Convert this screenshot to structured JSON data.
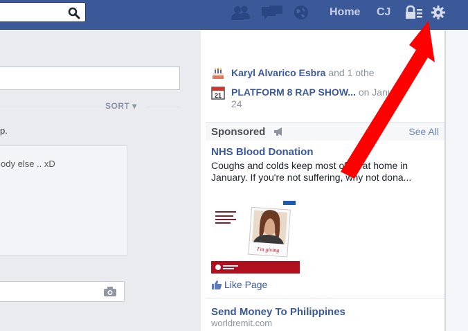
{
  "topbar": {
    "home_label": "Home",
    "user_label": "CJ",
    "icons": [
      "friend-requests-icon",
      "messages-icon",
      "notifications-globe-icon",
      "privacy-shortcuts-icon",
      "settings-gear-icon"
    ]
  },
  "feed": {
    "sort_label": "SORT ▾",
    "story_text": "p.",
    "comment_text": "ody else .. xD"
  },
  "reminders": {
    "birthday": {
      "name": "Karyl Alvarico Esbra",
      "suffix": "and 1 othe"
    },
    "event": {
      "name": "PLATFORM 8 RAP SHOW...",
      "suffix": "on January",
      "date_line": "24"
    }
  },
  "sponsored": {
    "title": "Sponsored",
    "see_all": "See All",
    "ads": [
      {
        "title": "NHS Blood Donation",
        "body": "Coughs and colds keep most of us at home in January. If you're not suffering, why not dona...",
        "like_label": "Like Page",
        "image_caption": "I'm giving"
      },
      {
        "title": "Send Money To Philippines",
        "domain": "worldremit.com"
      }
    ]
  },
  "colors": {
    "topbar": "#3b5998",
    "link": "#3b5998",
    "arrow": "#ff0000"
  }
}
